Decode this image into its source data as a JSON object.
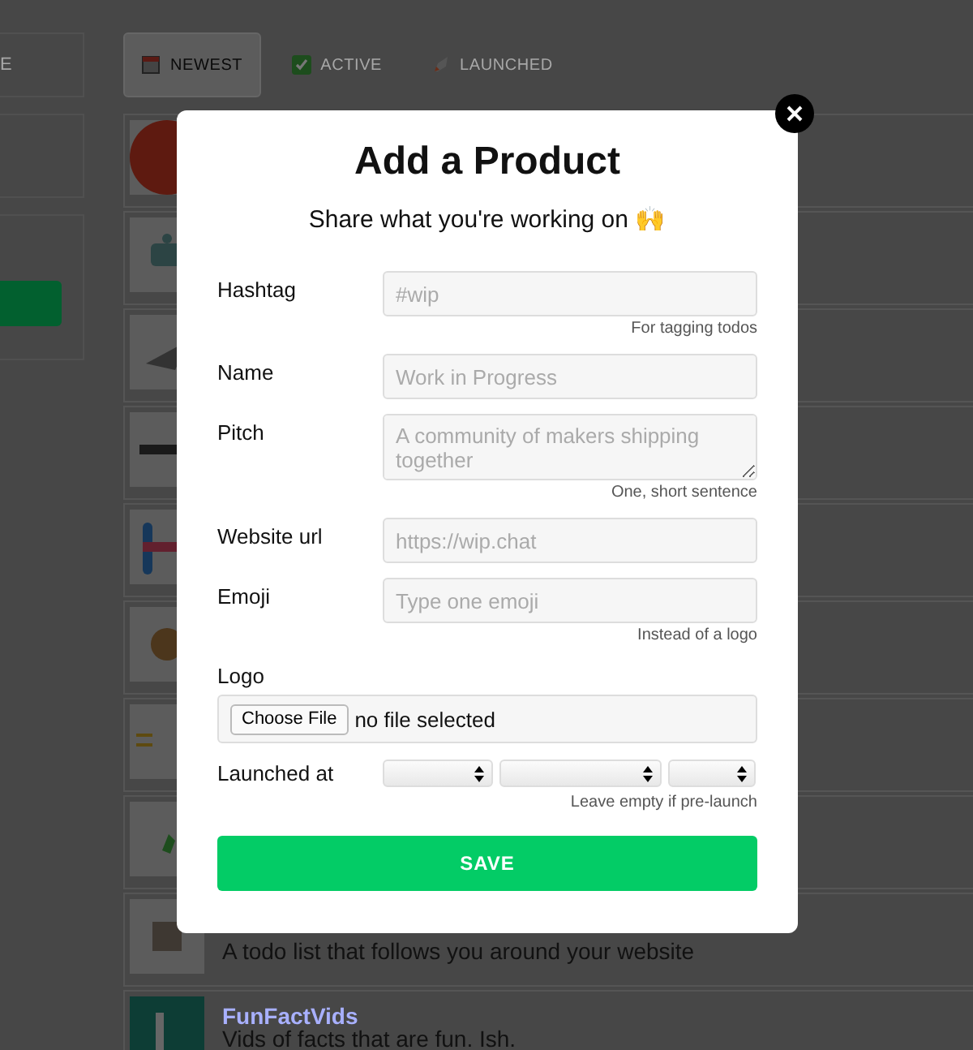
{
  "tabs": [
    {
      "label": "E",
      "selected": false
    },
    {
      "label": "NEWEST",
      "selected": true
    },
    {
      "label": "ACTIVE",
      "selected": false
    },
    {
      "label": "LAUNCHED",
      "selected": false
    }
  ],
  "products": [
    {
      "kind": "picture"
    },
    {
      "kind": "picture"
    },
    {
      "kind": "picture"
    },
    {
      "kind": "picture"
    },
    {
      "kind": "picture"
    },
    {
      "kind": "picture"
    },
    {
      "kind": "picture"
    },
    {
      "kind": "picture"
    },
    {
      "kind": "picture",
      "pitch": "A todo list that follows you around your website"
    },
    {
      "kind": "picture",
      "name": "FunFactVids",
      "pitch": "Vids of facts that are fun. Ish."
    }
  ],
  "modal": {
    "title": "Add a Product",
    "subtitle": "Share what you're working on 🙌",
    "fields": [
      {
        "kind": "input",
        "label": "Hashtag",
        "placeholder": "#wip",
        "hint": "For tagging todos"
      },
      {
        "kind": "input",
        "label": "Name",
        "placeholder": "Work in Progress"
      },
      {
        "kind": "textarea",
        "label": "Pitch",
        "placeholder": "A community of makers shipping together",
        "hint": "One, short sentence"
      },
      {
        "kind": "input",
        "label": "Website url",
        "placeholder": "https://wip.chat"
      },
      {
        "kind": "input",
        "label": "Emoji",
        "placeholder": "Type one emoji",
        "hint": "Instead of a logo"
      },
      {
        "kind": "file",
        "label": "Logo",
        "button": "Choose File",
        "status": "no file selected"
      },
      {
        "kind": "date",
        "label": "Launched at",
        "hint": "Leave empty if pre-launch"
      }
    ],
    "save": "SAVE"
  }
}
